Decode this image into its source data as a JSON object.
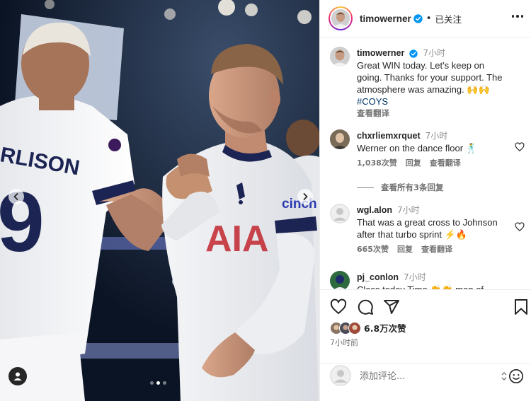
{
  "post": {
    "author": "timowerner",
    "follow_status": "已关注",
    "caption_time": "7小时",
    "caption_lines": [
      "Great WIN today. Let's keep on",
      "going. Thanks for your support. The",
      "atmosphere was amazing. 🙌🙌"
    ],
    "hashtag": "#COYS",
    "see_translation": "查看翻译"
  },
  "comments": [
    {
      "user": "chxrliemxrquet",
      "time": "7小时",
      "lines": [
        "Werner on the dance floor 🕺"
      ],
      "likes": "1,038次赞",
      "reply": "回复",
      "translate": "查看翻译"
    },
    {
      "user": "wgl.alon",
      "time": "7小时",
      "lines": [
        "That was a great cross to Johnson",
        "after that turbo sprint ⚡🔥"
      ],
      "likes": "665次赞",
      "reply": "回复",
      "translate": "查看翻译"
    },
    {
      "user": "pj_conlon",
      "time": "7小时",
      "lines": [
        "Class today Timo 👏👏 man of"
      ]
    }
  ],
  "view_replies": "查看所有3条回复",
  "likes_count": "6.8万次赞",
  "post_age": "7小时前",
  "comment_placeholder": "添加评论...",
  "jersey": {
    "sponsor": "cinch",
    "player_name": "RLISON"
  },
  "icons": [
    "verified-badge-icon",
    "more-options-icon",
    "heart-icon",
    "comment-icon",
    "share-icon",
    "bookmark-icon",
    "emoji-icon",
    "chevron-left-icon",
    "chevron-right-icon",
    "user-tag-icon"
  ],
  "colors": {
    "verified": "#0095f6",
    "hashtag": "#00376b",
    "muted": "#737373",
    "navy": "#1c2453",
    "fire": "#e55b13"
  },
  "carousel": {
    "slide_count": 3,
    "active_index": 1
  }
}
